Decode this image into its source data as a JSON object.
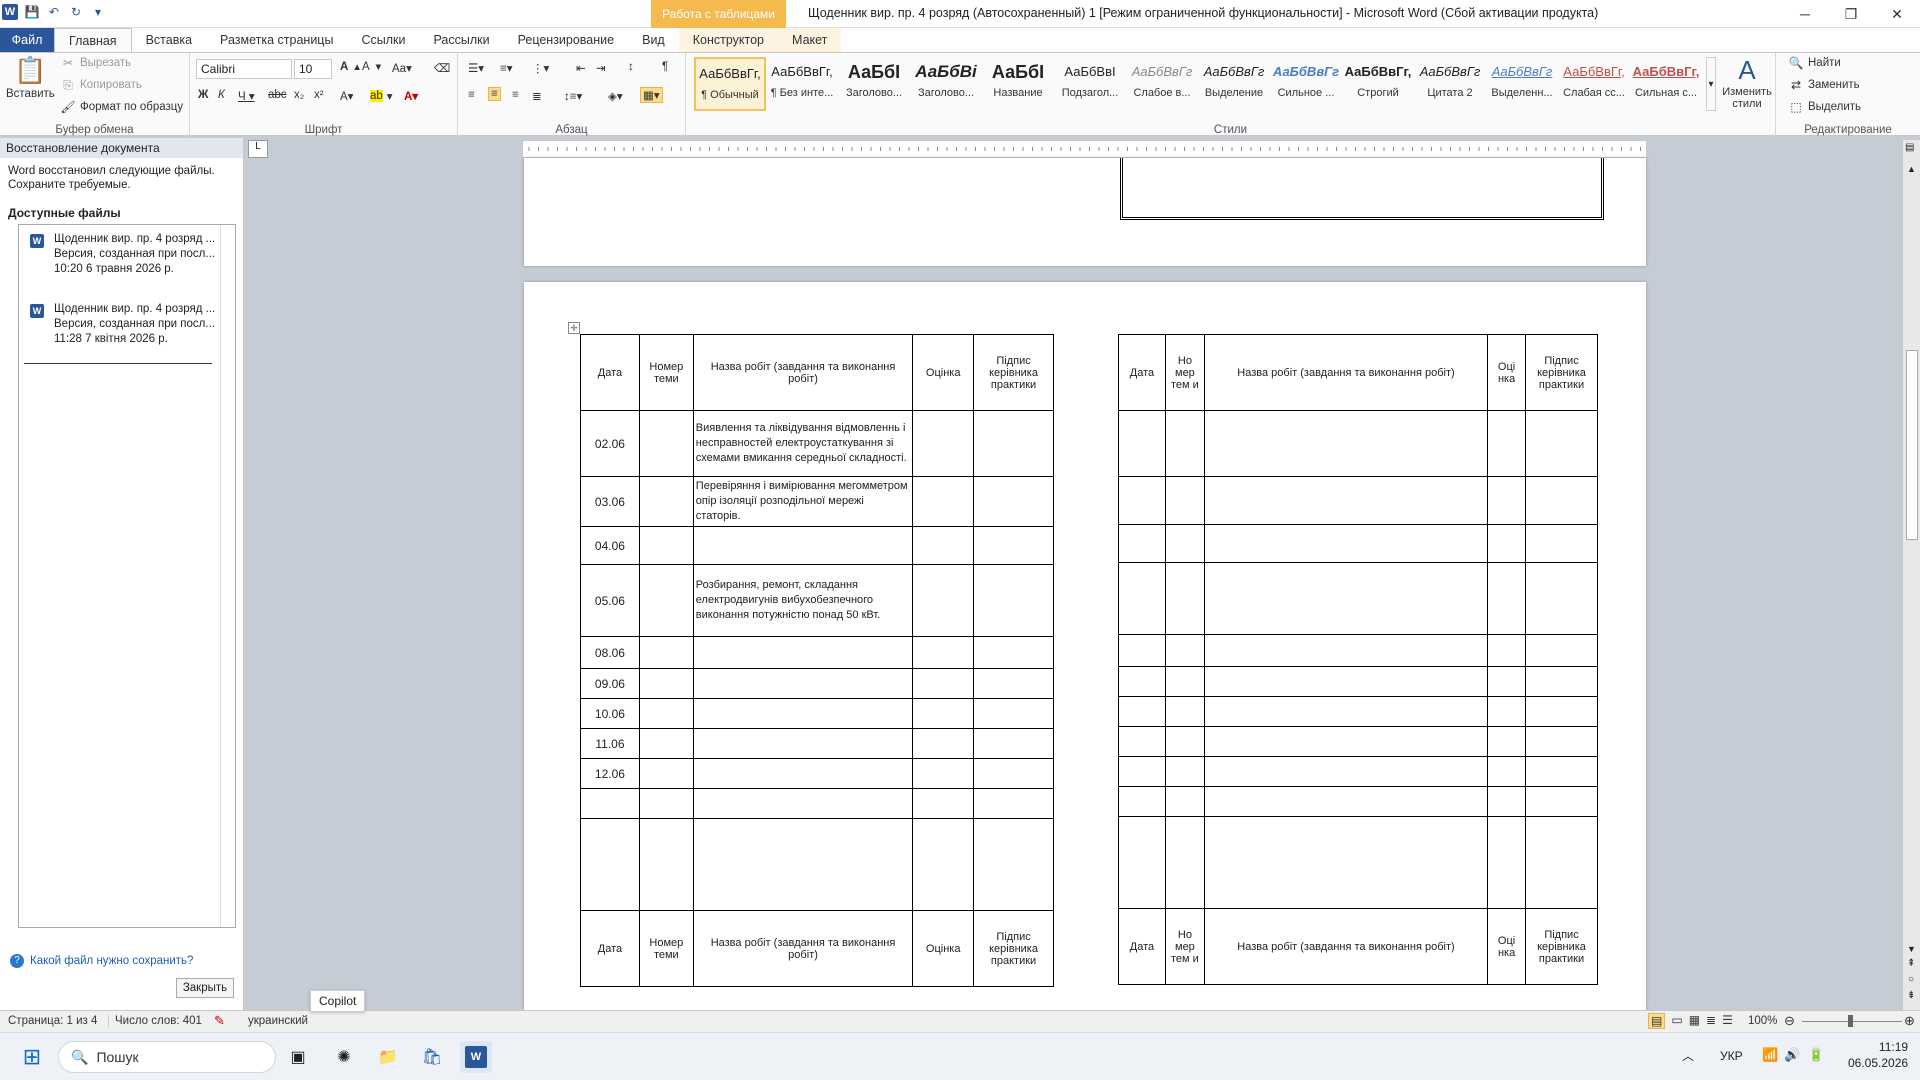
{
  "titlebar": {
    "context_group": "Работа с таблицами",
    "title": "Щоденник вир. пр. 4 розряд (Автосохраненный) 1 [Режим ограниченной функциональности]  -  Microsoft Word (Сбой активации продукта)"
  },
  "tabs": [
    "Файл",
    "Главная",
    "Вставка",
    "Разметка страницы",
    "Ссылки",
    "Рассылки",
    "Рецензирование",
    "Вид",
    "Конструктор",
    "Макет"
  ],
  "ribbon": {
    "clipboard": {
      "paste": "Вставить",
      "cut": "Вырезать",
      "copy": "Копировать",
      "format_painter": "Формат по образцу",
      "label": "Буфер обмена"
    },
    "font": {
      "name": "Calibri",
      "size": "10",
      "label": "Шрифт"
    },
    "paragraph": {
      "label": "Абзац"
    },
    "styles": {
      "label": "Стили",
      "items": [
        {
          "sample": "АаБбВвГг,",
          "name": "¶ Обычный"
        },
        {
          "sample": "АаБбВвГг,",
          "name": "¶ Без инте..."
        },
        {
          "sample": "АаБбІ",
          "name": "Заголово..."
        },
        {
          "sample": "АаБбВі",
          "name": "Заголово..."
        },
        {
          "sample": "АаБбІ",
          "name": "Название"
        },
        {
          "sample": "АаБбВвІ",
          "name": "Подзагол..."
        },
        {
          "sample": "АаБбВвГг",
          "name": "Слабое в..."
        },
        {
          "sample": "АаБбВвГг",
          "name": "Выделение"
        },
        {
          "sample": "АаБбВвГг",
          "name": "Сильное ..."
        },
        {
          "sample": "АаБбВвГг,",
          "name": "Строгий"
        },
        {
          "sample": "АаБбВвГг",
          "name": "Цитата 2"
        },
        {
          "sample": "АаБбВвГг",
          "name": "Выделенн..."
        },
        {
          "sample": "АаБбВвГг,",
          "name": "Слабая сс..."
        },
        {
          "sample": "АаБбВвГг,",
          "name": "Сильная с..."
        }
      ],
      "change": "Изменить стили"
    },
    "editing": {
      "find": "Найти",
      "replace": "Заменить",
      "select": "Выделить",
      "label": "Редактирование"
    }
  },
  "recovery": {
    "title": "Восстановление документа",
    "desc": "Word восстановил следующие файлы. Сохраните требуемые.",
    "available": "Доступные файлы",
    "files": [
      {
        "name": "Щоденник вир. пр. 4 розряд ...",
        "line2": "Версия, созданная при посл...",
        "line3": "10:20 6 травня 2026 р."
      },
      {
        "name": "Щоденник вир. пр. 4 розряд ...",
        "line2": "Версия, созданная при посл...",
        "line3": "11:28 7 квітня 2026 р."
      }
    ],
    "help": "Какой файл нужно сохранить?",
    "close": "Закрыть"
  },
  "table": {
    "headers": {
      "date": "Дата",
      "topic": "Номер теми",
      "work": "Назва робіт (завдання та виконання робіт)",
      "grade": "Оцінка",
      "sign": "Підпис керівника практики"
    },
    "headers_right": {
      "date": "Дата",
      "topic": "Но мер тем и",
      "work": "Назва робіт (завдання та виконання  робіт)",
      "grade": "Оці нка",
      "sign": "Підпис керівника практики"
    },
    "rows": [
      {
        "date": "02.06",
        "work": "Виявлення та ліквідування відмовленнь і несправностей електроустаткування зі схемами вмикання середньої складності."
      },
      {
        "date": "03.06",
        "work": "Перевіряння   і вимірювання мегомметром опір ізоляції розподільної мережі статорів."
      },
      {
        "date": "04.06",
        "work": ""
      },
      {
        "date": "05.06",
        "work": "Розбирання, ремонт, складання електродвигунів вибухобезпечного виконання потужністю понад 50 кВт."
      },
      {
        "date": "08.06",
        "work": ""
      },
      {
        "date": "09.06",
        "work": ""
      },
      {
        "date": "10.06",
        "work": ""
      },
      {
        "date": "11.06",
        "work": ""
      },
      {
        "date": "12.06",
        "work": ""
      },
      {
        "date": "",
        "work": ""
      },
      {
        "date": "",
        "work": ""
      }
    ]
  },
  "status": {
    "page": "Страница: 1 из 4",
    "words": "Число слов: 401",
    "lang": "украинский",
    "zoom": "100%"
  },
  "taskbar": {
    "search": "Пошук",
    "tooltip": "Copilot",
    "lang": "УКР",
    "time": "11:19",
    "date": "06.05.2026"
  }
}
